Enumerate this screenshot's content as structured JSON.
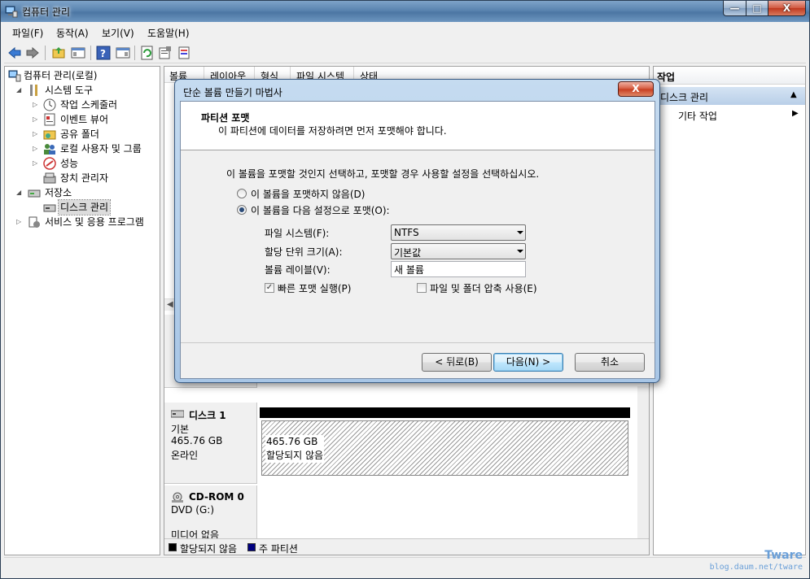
{
  "window": {
    "title": "컴퓨터 관리",
    "min": "—",
    "max": "□",
    "close": "X"
  },
  "menu": [
    "파일(F)",
    "동작(A)",
    "보기(V)",
    "도움말(H)"
  ],
  "tree": {
    "root": "컴퓨터 관리(로컬)",
    "system_tools": "시스템 도구",
    "task_scheduler": "작업 스케줄러",
    "event_viewer": "이벤트 뷰어",
    "shared_folders": "공유 폴더",
    "local_users": "로컬 사용자 및 그룹",
    "performance": "성능",
    "device_manager": "장치 관리자",
    "storage": "저장소",
    "disk_management": "디스크 관리",
    "services": "서비스 및 응용 프로그램"
  },
  "columns": [
    "볼륨",
    "레이아웃",
    "형식",
    "파일 시스템",
    "상태"
  ],
  "disks": [
    {
      "name": "디스크 1",
      "type": "기본",
      "size": "465.76 GB",
      "status": "온라인",
      "partition_size": "465.76 GB",
      "partition_status": "할당되지 않음"
    },
    {
      "name": "CD-ROM 0",
      "type": "DVD (G:)",
      "status": "미디어 없음"
    }
  ],
  "legend": {
    "unallocated": "할당되지 않음",
    "primary": "주 파티션",
    "unallocated_color": "#000000",
    "primary_color": "#000080"
  },
  "actions": {
    "header": "작업",
    "section": "디스크 관리",
    "more": "기타 작업"
  },
  "wizard": {
    "title": "단순 볼륨 만들기 마법사",
    "close": "X",
    "heading": "파티션 포맷",
    "subheading": "이 파티션에 데이터를 저장하려면 먼저 포맷해야 합니다.",
    "instruction": "이 볼륨을 포맷할 것인지 선택하고, 포맷할 경우 사용할 설정을 선택하십시오.",
    "radio_no_format": "이 볼륨을 포맷하지 않음(D)",
    "radio_format": "이 볼륨을 다음 설정으로 포맷(O):",
    "fs_label": "파일 시스템(F):",
    "fs_value": "NTFS",
    "alloc_label": "할당 단위 크기(A):",
    "alloc_value": "기본값",
    "vol_label": "볼륨 레이블(V):",
    "vol_value": "새 볼륨",
    "quick_format": "빠른 포맷 실행(P)",
    "compression": "파일 및 폴더 압축 사용(E)",
    "back": "< 뒤로(B)",
    "next": "다음(N) >",
    "cancel": "취소"
  },
  "watermark": {
    "brand": "Tware",
    "url": "blog.daum.net/tware"
  }
}
